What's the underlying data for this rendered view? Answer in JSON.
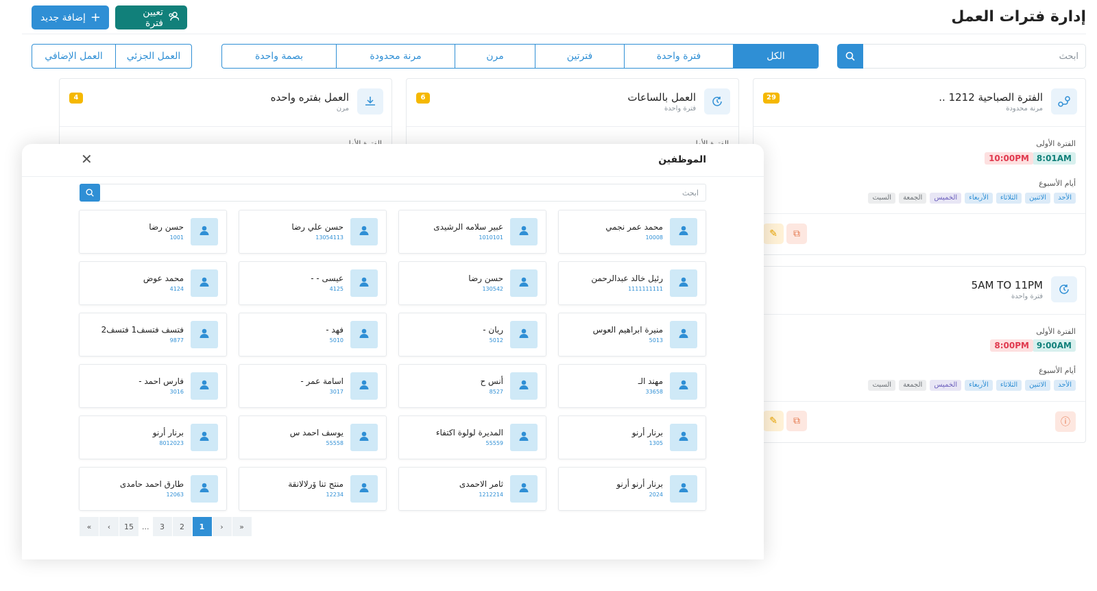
{
  "header": {
    "title": "إدارة فترات العمل",
    "add_label": "إضافة جديد",
    "assign_label": "تعيين فترة"
  },
  "filters": {
    "search_placeholder": "ابحث",
    "tabs": [
      "الكل",
      "فترة واحدة",
      "فترتين",
      "مرن",
      "مرنة محدودة",
      "بصمة واحدة"
    ],
    "active_tab": "الكل",
    "tabs2": [
      "العمل الجزئي",
      "العمل الإضافي"
    ]
  },
  "cards": [
    {
      "title": "الفترة الصباحية 1212 ..",
      "subtitle": "مرنة محدودة",
      "count": "29",
      "period_label": "الفترة الأولى",
      "start": "8:01AM",
      "end": "10:00PM",
      "days_label": "أيام الأسبوع",
      "days": [
        "الأحد",
        "الاثنين",
        "الثلاثاء",
        "الأربعاء",
        "الخميس",
        "الجمعة",
        "السبت"
      ]
    },
    {
      "title": "العمل بالساعات",
      "subtitle": "فترة واحدة",
      "count": "6",
      "period_label": "الفترة الأولى"
    },
    {
      "title": "العمل بفتره واحده",
      "subtitle": "مرن",
      "count": "4",
      "period_label": "الفترة الأولى"
    },
    {
      "title": "5AM TO 11PM",
      "subtitle": "فترة واحدة",
      "period_label": "الفترة الأولى",
      "start": "9:00AM",
      "end": "8:00PM",
      "days_label": "أيام الأسبوع",
      "days": [
        "الأحد",
        "الاثنين",
        "الثلاثاء",
        "الأربعاء",
        "الخميس",
        "الجمعة",
        "السبت"
      ]
    }
  ],
  "modal": {
    "title": "الموظفين",
    "search_placeholder": "ابحث",
    "employees": [
      {
        "name": "محمد عمر نجمي",
        "code": "10008"
      },
      {
        "name": "عبير سلامه الرشيدى",
        "code": "1010101"
      },
      {
        "name": "حسن علي رضا",
        "code": "13054113"
      },
      {
        "name": "حسن رضا",
        "code": "1001"
      },
      {
        "name": "رئيل خالد عبدالرحمن",
        "code": "1111111111"
      },
      {
        "name": "حسن رضا",
        "code": "130542"
      },
      {
        "name": "عيسى - -",
        "code": "4125"
      },
      {
        "name": "محمد عوض",
        "code": "4124"
      },
      {
        "name": "منيرة ابراهيم العوس",
        "code": "5013"
      },
      {
        "name": "ريان -",
        "code": "5012"
      },
      {
        "name": "فهد -",
        "code": "5010"
      },
      {
        "name": "فتسف فتسف1 فتسف2",
        "code": "9877"
      },
      {
        "name": "مهند الـ",
        "code": "33658"
      },
      {
        "name": "أنس ح",
        "code": "8527"
      },
      {
        "name": "اسامة عمر -",
        "code": "3017"
      },
      {
        "name": "فارس احمد -",
        "code": "3016"
      },
      {
        "name": "برنار أرنو",
        "code": "1305"
      },
      {
        "name": "المديرة لولوة اكتفاء",
        "code": "55559"
      },
      {
        "name": "يوسف احمد س",
        "code": "55558"
      },
      {
        "name": "برنار أرنو",
        "code": "8012023"
      },
      {
        "name": "برنار أرنو أرنو",
        "code": "2024"
      },
      {
        "name": "ثامر الاحمدى",
        "code": "1212214"
      },
      {
        "name": "منتج تنا ۆرلالانقة",
        "code": "12234"
      },
      {
        "name": "طارق احمد حامدى",
        "code": "12063"
      }
    ],
    "pagination": [
      "«",
      "‹",
      "15",
      "...",
      "3",
      "2",
      "1",
      "›",
      "»"
    ],
    "active_page": "1"
  },
  "colors": {
    "primary": "#2f8fd5",
    "teal": "#11807a",
    "badge": "#f5b800"
  }
}
